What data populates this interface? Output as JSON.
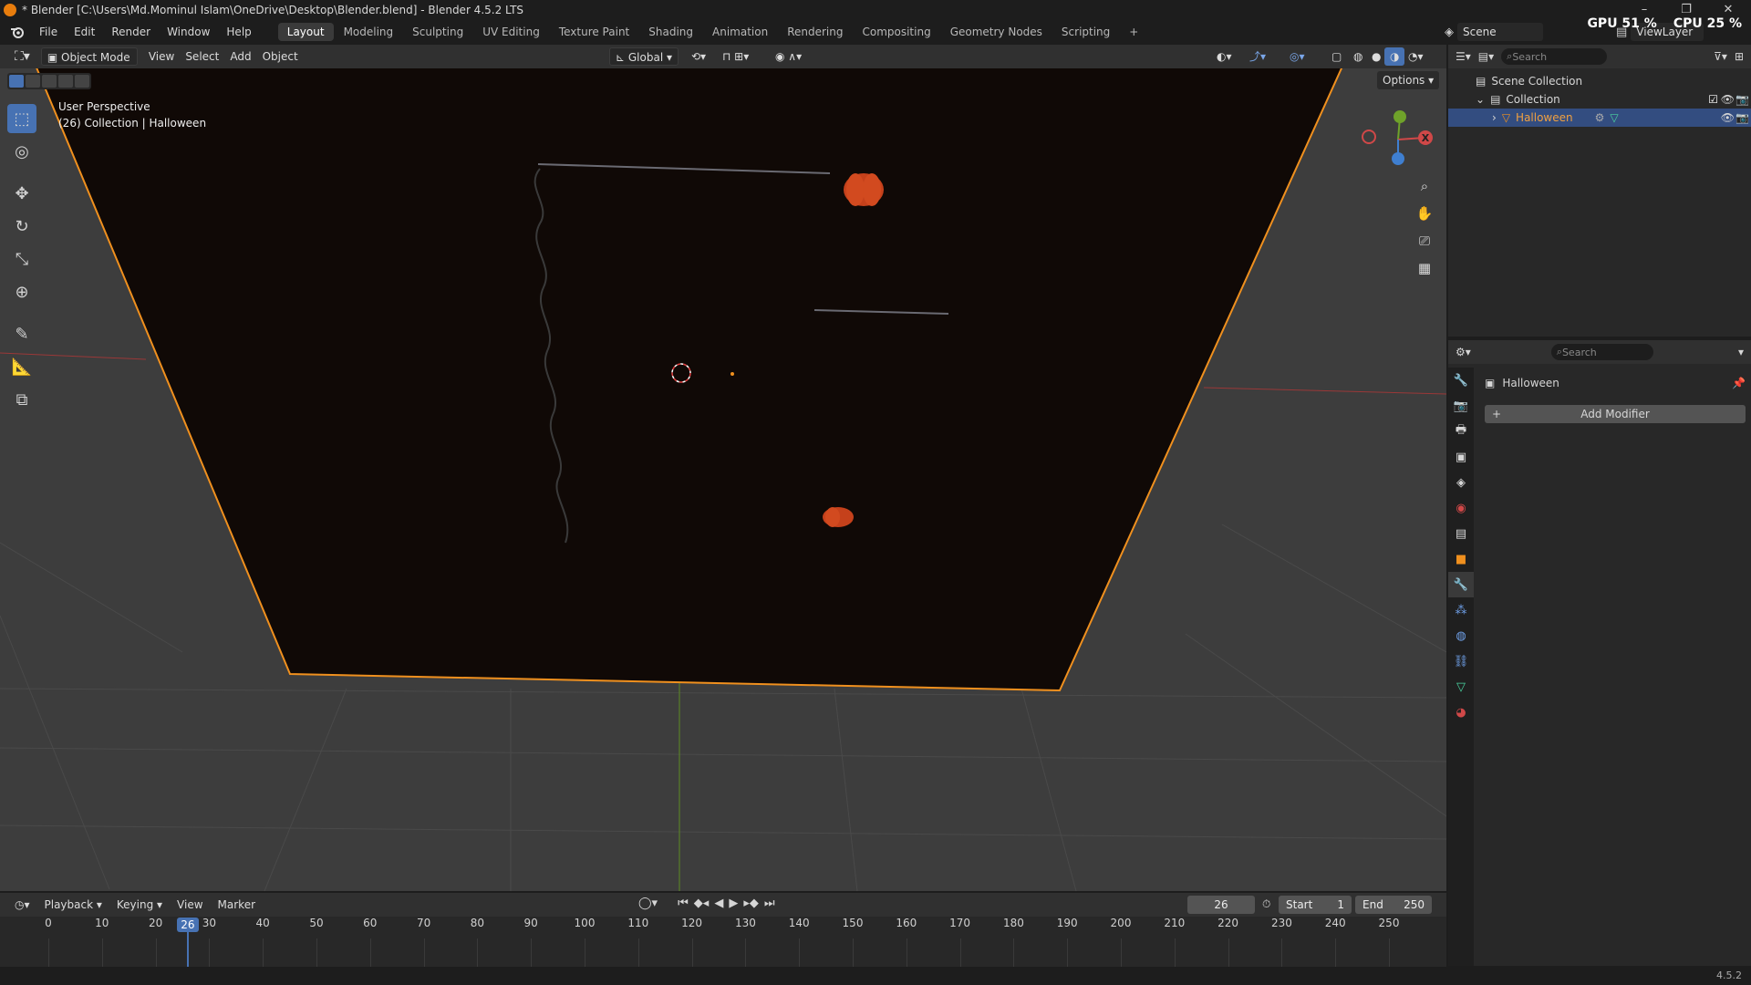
{
  "window": {
    "title": "* Blender [C:\\Users\\Md.Mominul Islam\\OneDrive\\Desktop\\Blender.blend] - Blender 4.5.2 LTS",
    "minimize": "–",
    "restore": "❐",
    "close": "✕"
  },
  "menu": {
    "items": [
      "File",
      "Edit",
      "Render",
      "Window",
      "Help"
    ]
  },
  "workspaces": {
    "tabs": [
      "Layout",
      "Modeling",
      "Sculpting",
      "UV Editing",
      "Texture Paint",
      "Shading",
      "Animation",
      "Rendering",
      "Compositing",
      "Geometry Nodes",
      "Scripting"
    ],
    "active": "Layout",
    "add": "+"
  },
  "topright": {
    "scene": "Scene",
    "viewlayer": "ViewLayer",
    "gpu": "GPU 51 %",
    "cpu": "CPU 25 %"
  },
  "viewport": {
    "mode": "Object Mode",
    "view": "View",
    "select": "Select",
    "add": "Add",
    "object": "Object",
    "orientation": "Global",
    "options": "Options",
    "perspective": "User Perspective",
    "collection_info": "(26) Collection | Halloween",
    "gizmo": {
      "x": "X"
    }
  },
  "outliner": {
    "search_placeholder": "Search",
    "scene_collection": "Scene Collection",
    "collection": "Collection",
    "object": "Halloween"
  },
  "properties": {
    "search_placeholder": "Search",
    "object_name": "Halloween",
    "add_modifier": "Add Modifier",
    "plus": "+"
  },
  "timeline": {
    "playback": "Playback",
    "keying": "Keying",
    "view": "View",
    "marker": "Marker",
    "current_frame": "26",
    "start_label": "Start",
    "start": "1",
    "end_label": "End",
    "end": "250",
    "ticks": [
      "0",
      "10",
      "20",
      "30",
      "40",
      "50",
      "60",
      "70",
      "80",
      "90",
      "100",
      "110",
      "120",
      "130",
      "140",
      "150",
      "160",
      "170",
      "180",
      "190",
      "200",
      "210",
      "220",
      "230",
      "240",
      "250"
    ],
    "playhead": 26
  },
  "status": {
    "version": "4.5.2"
  },
  "colors": {
    "accent": "#4772b3",
    "selection_outline": "#f0901e",
    "x_axis": "#d04848",
    "y_axis": "#6fa22a",
    "z_axis": "#3f7fd0",
    "pumpkin": "#d0441c"
  }
}
